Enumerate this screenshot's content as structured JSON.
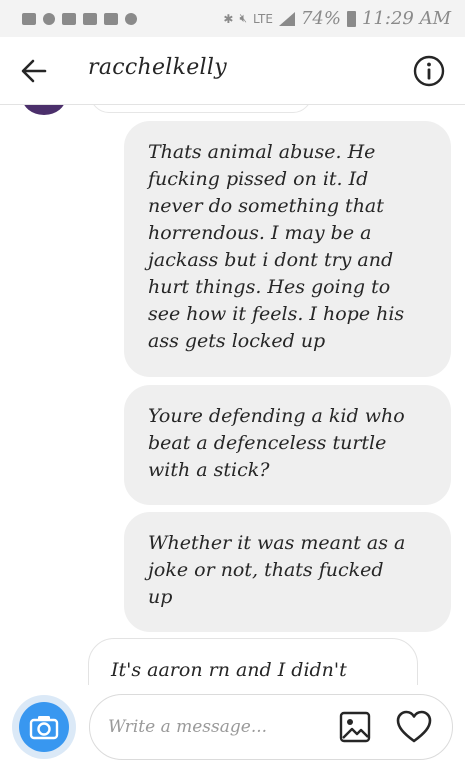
{
  "status_bar": {
    "lte_label": "LTE",
    "battery_percent": "74%",
    "time": "11:29 AM",
    "icons": [
      "message-icon",
      "snapchat-icon",
      "app-icon",
      "app-icon",
      "image-icon",
      "settings-icon",
      "bluetooth-icon",
      "mute-icon",
      "signal-icon",
      "battery-icon"
    ]
  },
  "header": {
    "title": "racchelkelly",
    "back_icon": "arrow-left-icon",
    "info_icon": "info-icon"
  },
  "messages": [
    {
      "direction": "outgoing",
      "text": "Thats animal abuse. He\nfucking pissed on it. Id\nnever do something that\nhorrendous. I may be a\njackass but i dont try and\nhurt things. Hes going to\nsee how it feels. I hope his\nass gets locked up"
    },
    {
      "direction": "outgoing",
      "text": "Youre defending a kid who\nbeat a defenceless turtle\nwith a stick?"
    },
    {
      "direction": "outgoing",
      "text": "Whether it was meant as a\njoke or not, thats fucked\nup"
    },
    {
      "direction": "incoming",
      "text": "It's aaron rn and I didn't"
    }
  ],
  "composer": {
    "placeholder": "Write a message...",
    "camera_icon": "camera-icon",
    "gallery_icon": "image-icon",
    "like_icon": "heart-icon"
  },
  "colors": {
    "accent": "#3897f0",
    "bubble_bg": "#efefef",
    "text": "#262626"
  }
}
